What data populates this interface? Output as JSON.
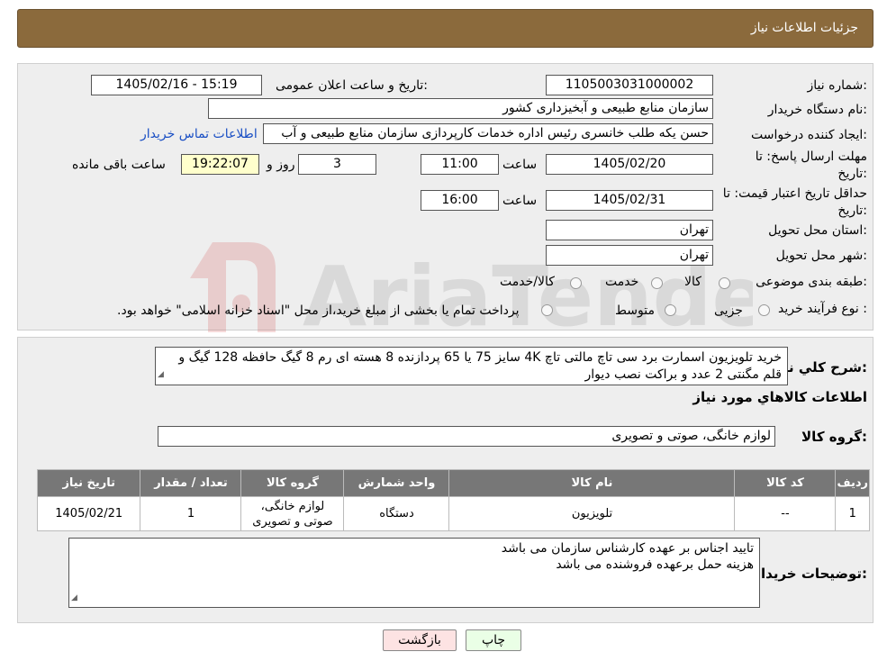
{
  "header": {
    "title": "جزئیات اطلاعات نیاز"
  },
  "form": {
    "need_number_label": "شماره نیاز:",
    "need_number": "1105003031000002",
    "announce_label": "تاریخ و ساعت اعلان عمومی:",
    "announce_value": "1405/02/16 - 15:19",
    "buyer_org_label": "نام دستگاه خریدار:",
    "buyer_org": "سازمان منابع طبیعی و آبخیزداری کشور",
    "creator_label": "ایجاد کننده درخواست:",
    "creator": "حسن یکه طلب خانسری رئیس اداره خدمات کارپردازی سازمان منابع طبیعی و آب",
    "contact_link": "اطلاعات تماس خریدار",
    "deadline_label": "مهلت ارسال پاسخ: تا تاریخ:",
    "deadline_date": "1405/02/20",
    "time_label": "ساعت",
    "deadline_time": "11:00",
    "days_value": "3",
    "days_label": "روز و",
    "remaining_time": "19:22:07",
    "remaining_label": "ساعت باقی مانده",
    "validity_label": "حداقل تاریخ اعتبار قیمت: تا تاریخ:",
    "validity_date": "1405/02/31",
    "validity_time": "16:00",
    "province_label": "استان محل تحویل:",
    "province": "تهران",
    "city_label": "شهر محل تحویل:",
    "city": "تهران",
    "category_label": "طبقه بندی موضوعی:",
    "category_options": [
      "کالا",
      "خدمت",
      "کالا/خدمت"
    ],
    "process_label": "نوع فرآیند خرید :",
    "process_options": [
      "جزیی",
      "متوسط"
    ],
    "process_note": "پرداخت تمام یا بخشی از مبلغ خرید،از محل \"اسناد خزانه اسلامی\" خواهد بود."
  },
  "details": {
    "summary_label": "شرح کلي نياز:",
    "summary_text": "خرید تلویزیون اسمارت برد سی تاچ مالتی تاچ 4K سایز 75 یا 65 پردازنده 8 هسته ای رم 8 گیگ حافظه 128 گیگ و قلم مگنتی 2 عدد و براکت نصب دیوار",
    "goods_info_title": "اطلاعات کالاهاي مورد نياز",
    "goods_group_label": "گروه کالا:",
    "goods_group": "لوازم خانگی، صوتی و تصویری",
    "table": {
      "headers": [
        "رديف",
        "کد کالا",
        "نام کالا",
        "واحد شمارش",
        "گروه کالا",
        "تعداد / مقدار",
        "تاريخ نياز"
      ],
      "rows": [
        [
          "1",
          "--",
          "تلویزیون",
          "دستگاه",
          "لوازم خانگی، صوتی و تصویری",
          "1",
          "1405/02/21"
        ]
      ]
    },
    "buyer_notes_label": "توضيحات خريدار:",
    "buyer_notes": [
      "تایید اجناس بر عهده کارشناس  سازمان می باشد",
      "هزینه حمل برعهده فروشنده می باشد"
    ]
  },
  "buttons": {
    "print": "چاپ",
    "back": "بازگشت"
  },
  "watermark": "AriaTender.neT",
  "colors": {
    "header": "#8b6a3c",
    "table_header": "#777777",
    "remaining_bg": "#ffffcc",
    "back_button_bg": "#fde3e3",
    "print_button_bg": "#eaffe6"
  }
}
